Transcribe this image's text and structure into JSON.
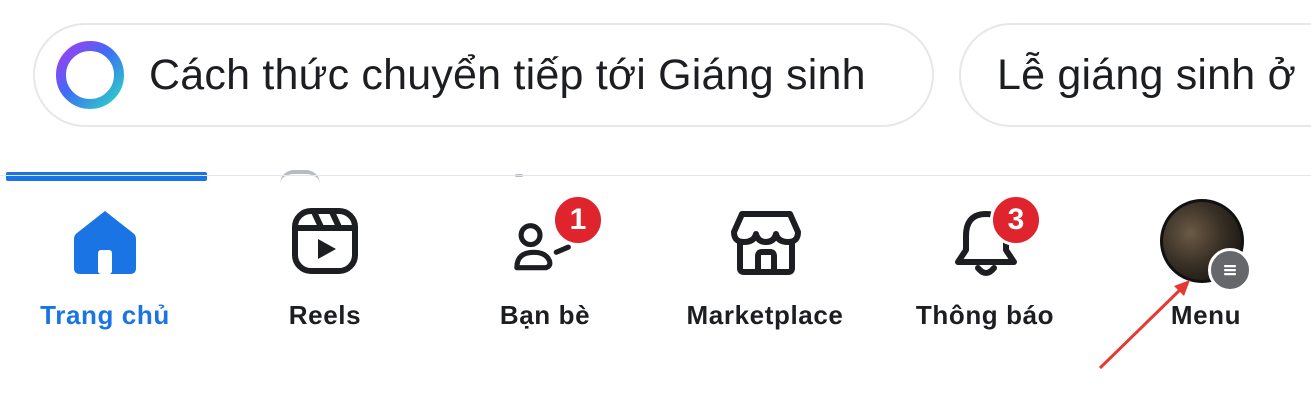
{
  "chips": [
    {
      "label": "Cách thức chuyển tiếp tới Giáng sinh",
      "icon": "meta-ai-ring-icon"
    },
    {
      "label": "Lễ giáng sinh ở"
    }
  ],
  "tabs": [
    {
      "label": "Trang chủ",
      "icon": "home-icon",
      "active": true
    },
    {
      "label": "Reels",
      "icon": "reels-icon"
    },
    {
      "label": "Bạn bè",
      "icon": "friends-icon",
      "badge": "1"
    },
    {
      "label": "Marketplace",
      "icon": "marketplace-icon"
    },
    {
      "label": "Thông báo",
      "icon": "bell-icon",
      "badge": "3"
    },
    {
      "label": "Menu",
      "icon": "avatar-menu-icon"
    }
  ],
  "colors": {
    "accent": "#1b74e4",
    "badge": "#e0242e",
    "annotation_arrow": "#e53935"
  }
}
